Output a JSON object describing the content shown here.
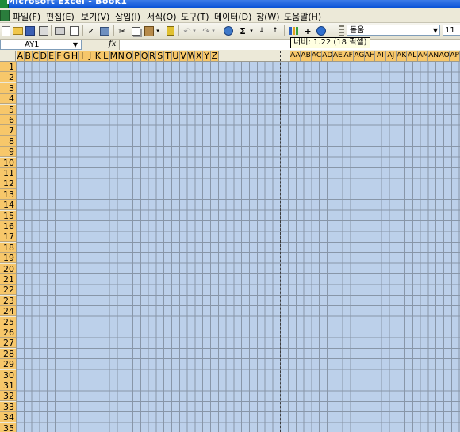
{
  "window": {
    "title": "Microsoft Excel - Book1"
  },
  "menu": [
    "파일(F)",
    "편집(E)",
    "보기(V)",
    "삽입(I)",
    "서식(O)",
    "도구(T)",
    "데이터(D)",
    "창(W)",
    "도움말(H)"
  ],
  "toolbar": {
    "font_name": "돋움",
    "font_size": "11",
    "buttons": [
      "new-icon",
      "open-icon",
      "save-icon",
      "permission-icon",
      "print-icon",
      "print-preview-icon",
      "spelling-icon",
      "research-icon",
      "cut-icon",
      "copy-icon",
      "paste-icon",
      "format-painter-icon",
      "undo-icon",
      "redo-icon",
      "hyperlink-icon",
      "autosum-icon",
      "sort-ascending-icon",
      "sort-descending-icon",
      "chart-wizard-icon",
      "drawing-icon",
      "help-icon"
    ]
  },
  "formula_bar": {
    "name_box": "AY1",
    "fx": "fx",
    "value": ""
  },
  "tooltip": "너비: 1.22 (18 픽셀)",
  "columns": [
    "A",
    "B",
    "C",
    "D",
    "E",
    "F",
    "G",
    "H",
    "I",
    "J",
    "K",
    "L",
    "M",
    "N",
    "O",
    "P",
    "Q",
    "R",
    "S",
    "T",
    "U",
    "V",
    "W",
    "X",
    "Y",
    "Z",
    "AA",
    "AB",
    "AC",
    "AD",
    "AE",
    "AF",
    "AG",
    "AH",
    "AI",
    "AJ",
    "AK",
    "AL",
    "AM",
    "AN",
    "AO",
    "AP"
  ],
  "rows": [
    "1",
    "2",
    "3",
    "4",
    "5",
    "6",
    "7",
    "8",
    "9",
    "10",
    "11",
    "12",
    "13",
    "14",
    "15",
    "16",
    "17",
    "18",
    "19",
    "20",
    "21",
    "22",
    "23",
    "24",
    "25",
    "26",
    "27",
    "28",
    "29",
    "30",
    "31",
    "32",
    "33",
    "34",
    "35"
  ],
  "colors": {
    "selection": "#bcd0ea",
    "header_selected": "#f7c76a",
    "titlebar": "#0a52d6",
    "chrome": "#ece9d8"
  }
}
